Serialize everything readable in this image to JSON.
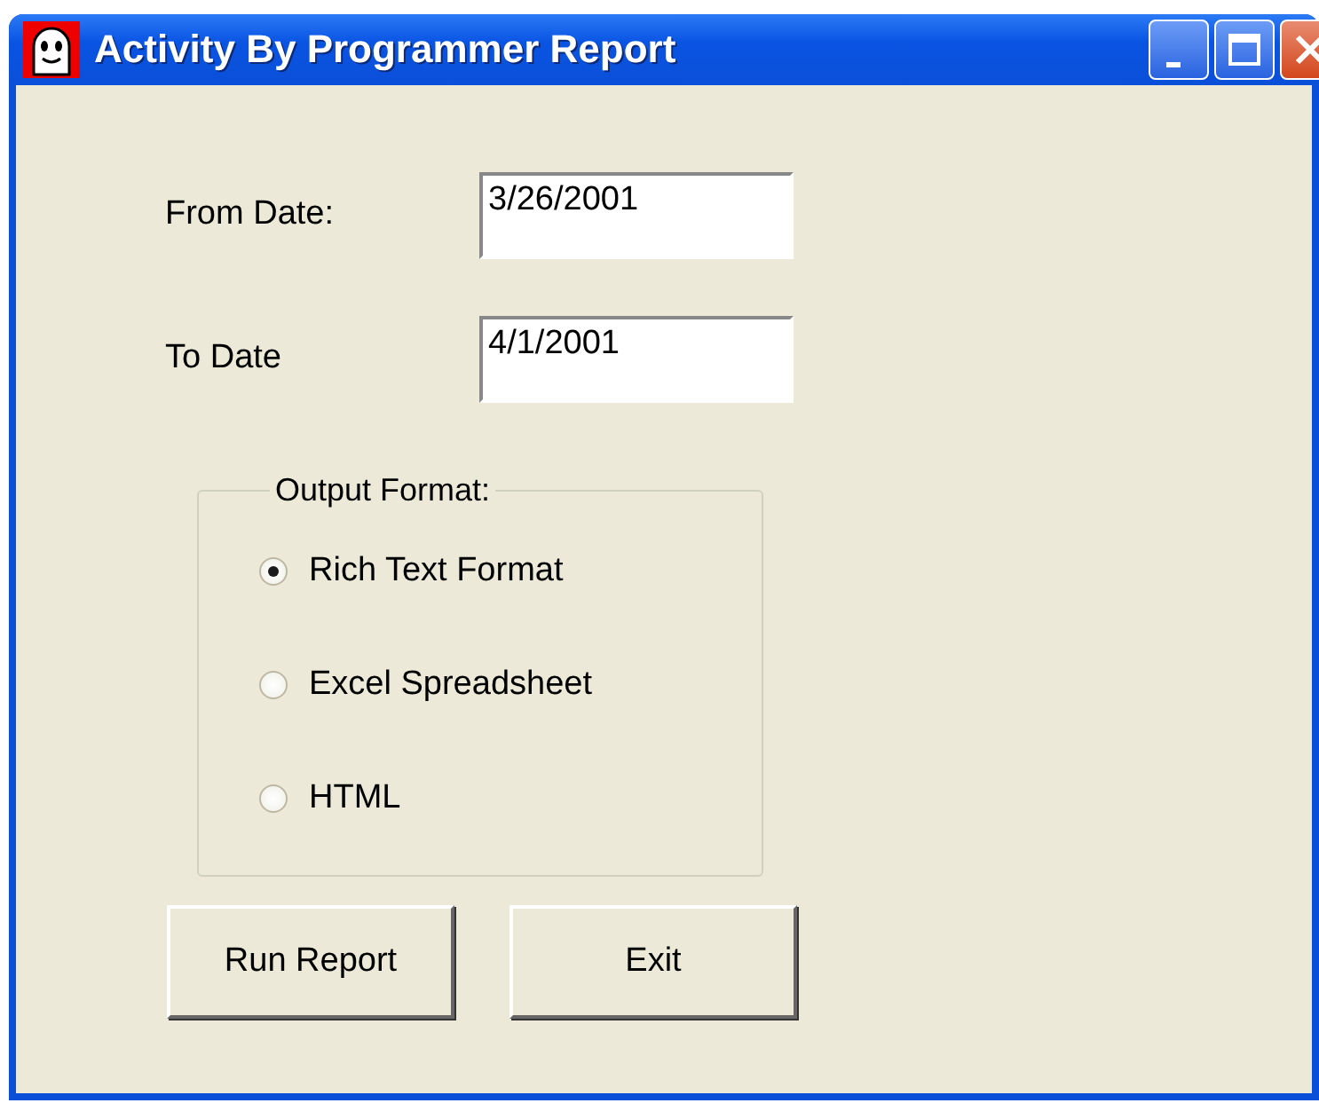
{
  "window": {
    "title": "Activity By Programmer Report"
  },
  "fields": [
    {
      "label": "From Date:",
      "value": "3/26/2001"
    },
    {
      "label": "To Date",
      "value": "4/1/2001"
    }
  ],
  "output_format": {
    "legend": "Output Format:",
    "options": [
      {
        "label": "Rich Text Format",
        "selected": true
      },
      {
        "label": "Excel Spreadsheet",
        "selected": false
      },
      {
        "label": "HTML",
        "selected": false
      }
    ]
  },
  "buttons": [
    {
      "label": "Run Report"
    },
    {
      "label": "Exit"
    }
  ]
}
